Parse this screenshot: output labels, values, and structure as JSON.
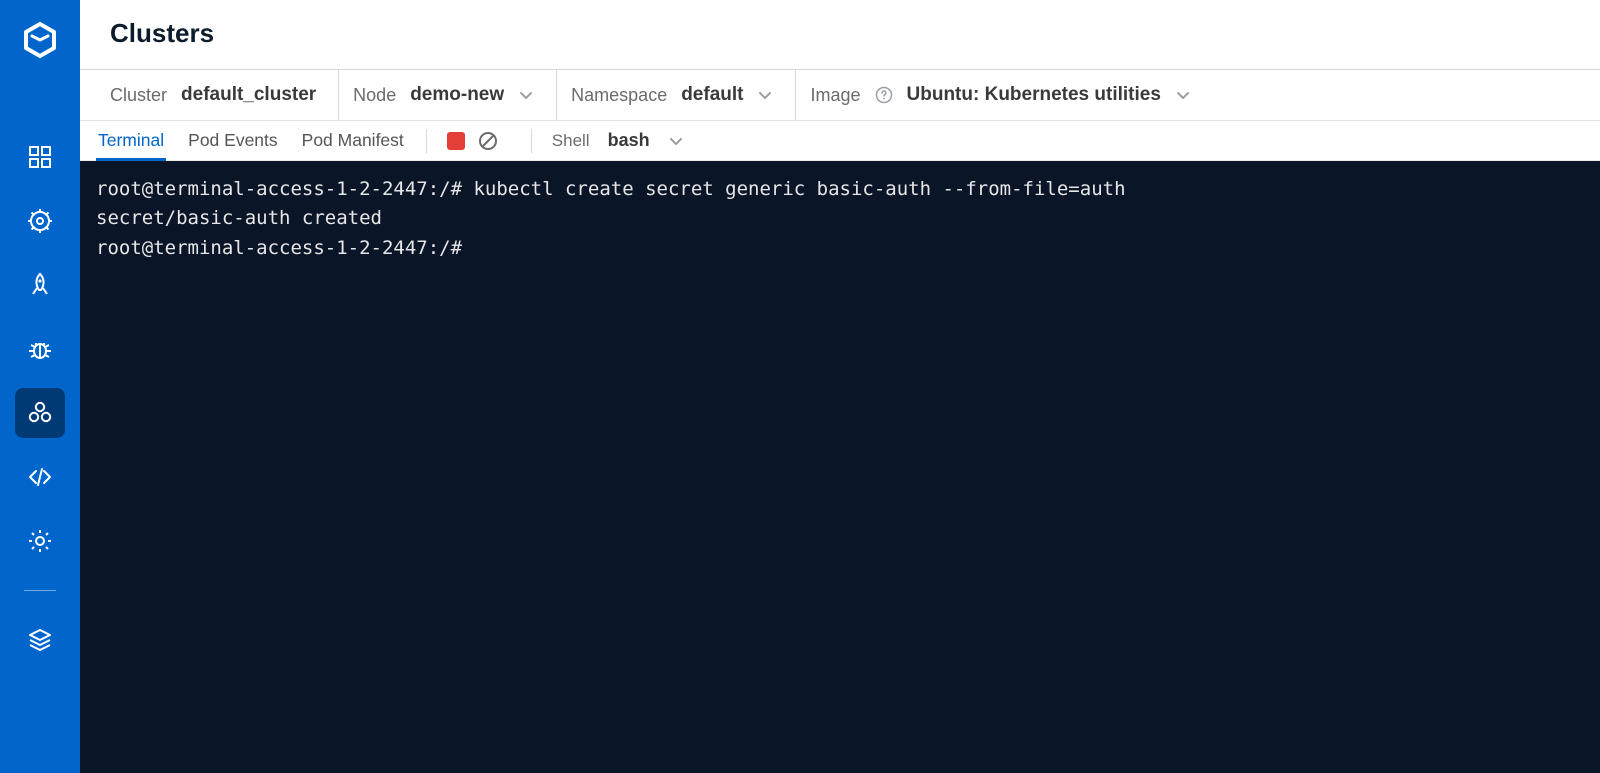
{
  "page": {
    "title": "Clusters"
  },
  "filters": {
    "cluster": {
      "label": "Cluster",
      "value": "default_cluster"
    },
    "node": {
      "label": "Node",
      "value": "demo-new"
    },
    "namespace": {
      "label": "Namespace",
      "value": "default"
    },
    "image": {
      "label": "Image",
      "value": "Ubuntu: Kubernetes utilities"
    }
  },
  "tabs": {
    "terminal": "Terminal",
    "pod_events": "Pod Events",
    "pod_manifest": "Pod Manifest",
    "active": "terminal"
  },
  "shell": {
    "label": "Shell",
    "value": "bash"
  },
  "terminal": {
    "lines": [
      "root@terminal-access-1-2-2447:/# kubectl create secret generic basic-auth --from-file=auth",
      "secret/basic-auth created",
      "root@terminal-access-1-2-2447:/#"
    ]
  },
  "sidebar": {
    "icons": [
      "apps-icon",
      "helm-icon",
      "launch-icon",
      "bug-icon",
      "resources-icon",
      "code-icon",
      "settings-icon",
      "stack-icon"
    ],
    "active_index": 4
  }
}
